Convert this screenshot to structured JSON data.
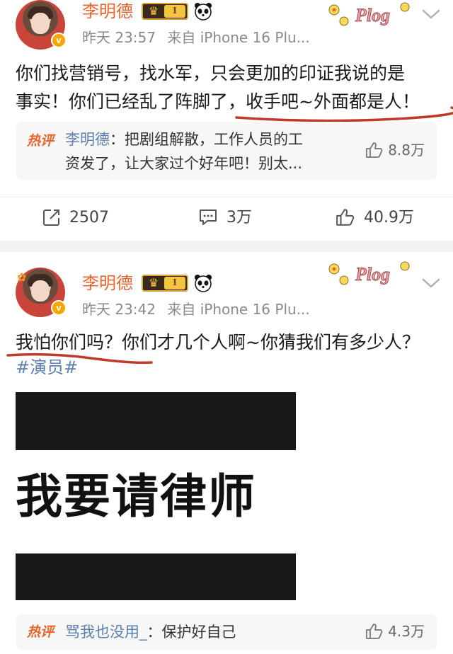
{
  "colors": {
    "accent": "#e8652c",
    "link": "#5b7fb0",
    "meta": "#8a8a8a",
    "underline": "#c0392b"
  },
  "posts": [
    {
      "author": "李明德",
      "level": "I",
      "time": "昨天 23:57",
      "source": "来自 iPhone 16 Plu...",
      "text_line1": "你们找营销号，找水军，只会更加的印证我说的是",
      "text_line2": "事实！你们已经乱了阵脚了，收手吧~外面都是人！",
      "hot_comment": {
        "tag": "热评",
        "user": "李明德",
        "line1": "：把剧组解散，工作人员的工",
        "line2": "资发了，让大家过个好年吧！别太...",
        "likes": "8.8万"
      },
      "actions": {
        "repost": "2507",
        "comment": "3万",
        "like": "40.9万"
      }
    },
    {
      "author": "李明德",
      "level": "I",
      "time": "昨天 23:42",
      "source": "来自 iPhone 16 Plu...",
      "text_line1": "我怕你们吗？你们才几个人啊~你猜我们有多少人？",
      "hashtag": "#演员#",
      "image_text": "我要请律师",
      "hot_comment": {
        "tag": "热评",
        "user": "骂我也没用_",
        "line1": "：保护好自己",
        "likes": "4.3万"
      }
    }
  ],
  "icons": [
    "v-badge-icon",
    "crown-badge-icon",
    "panda-icon",
    "plog-sticker-icon",
    "chevron-down-icon",
    "repost-icon",
    "comment-icon",
    "like-icon"
  ]
}
